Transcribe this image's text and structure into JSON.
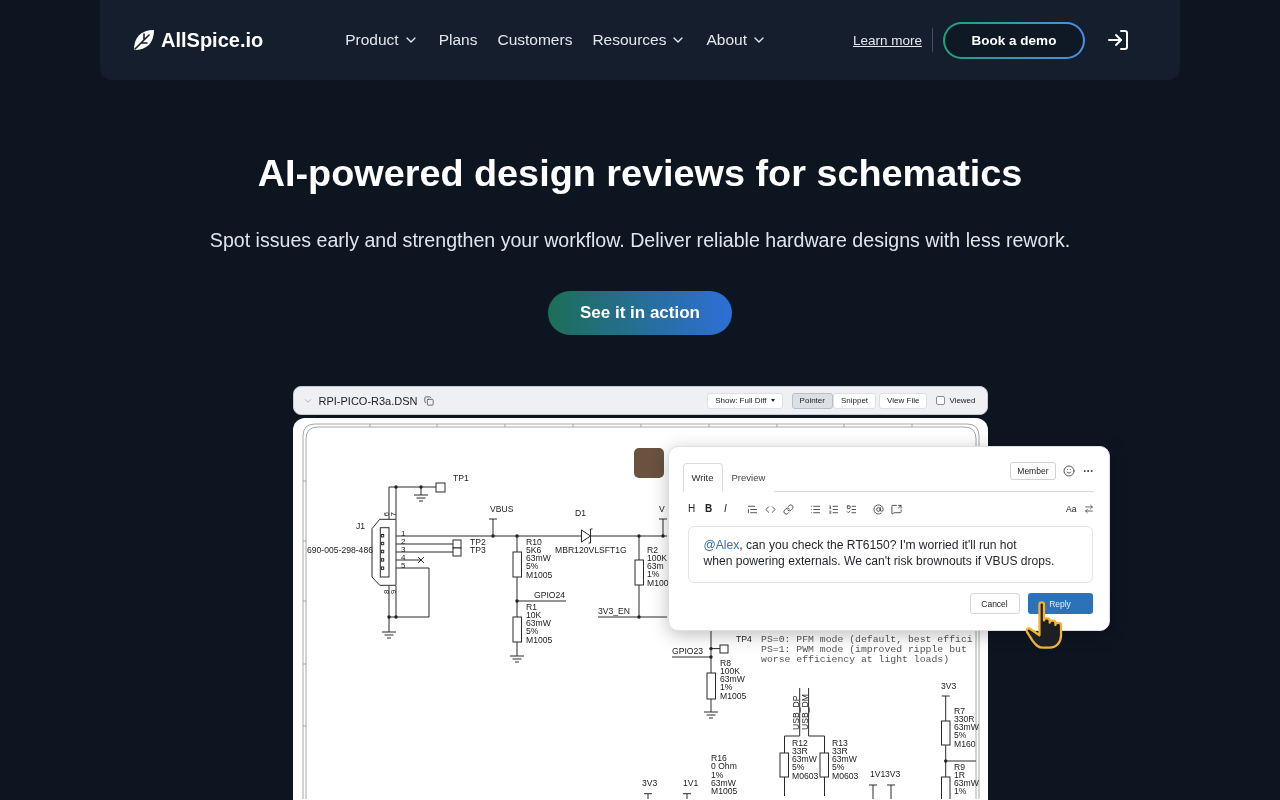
{
  "nav": {
    "logo": "AllSpice.io",
    "items": [
      {
        "label": "Product",
        "dropdown": true
      },
      {
        "label": "Plans",
        "dropdown": false
      },
      {
        "label": "Customers",
        "dropdown": false
      },
      {
        "label": "Resources",
        "dropdown": true
      },
      {
        "label": "About",
        "dropdown": true
      }
    ],
    "link": "Learn more",
    "button": "Book a demo"
  },
  "hero": {
    "title": "AI-powered design reviews for schematics",
    "subtitle": "Spot issues early and strengthen your workflow. Deliver reliable hardware designs with less rework.",
    "button": "See it in action"
  },
  "file_view": {
    "file_name": "RPI-PICO-R3a.DSN",
    "show_menu": "Show: Full Diff",
    "modes": [
      {
        "label": "Pointer",
        "selected": true
      },
      {
        "label": "Snippet",
        "selected": false
      }
    ],
    "view_button": "View File",
    "viewed": {
      "label": "Viewed",
      "checked": false
    }
  },
  "schematic": {
    "labels": [
      {
        "kind": "ref",
        "lines": [
          "TP1"
        ]
      },
      {
        "kind": "ref",
        "lines": [
          "J1"
        ]
      },
      {
        "kind": "ref",
        "lines": [
          "690-005-298-486"
        ]
      },
      {
        "kind": "pin",
        "lines": [
          "1"
        ]
      },
      {
        "kind": "pin",
        "lines": [
          "2"
        ]
      },
      {
        "kind": "pin",
        "lines": [
          "3"
        ]
      },
      {
        "kind": "pin",
        "lines": [
          "4"
        ]
      },
      {
        "kind": "pin",
        "lines": [
          "5"
        ]
      },
      {
        "kind": "pin_vertical",
        "lines": [
          "6"
        ]
      },
      {
        "kind": "pin_vertical",
        "lines": [
          "7"
        ]
      },
      {
        "kind": "pin_vertical",
        "lines": [
          "8"
        ]
      },
      {
        "kind": "pin_vertical",
        "lines": [
          "9"
        ]
      },
      {
        "kind": "net",
        "lines": [
          "VBUS"
        ]
      },
      {
        "kind": "ref",
        "lines": [
          "D1"
        ]
      },
      {
        "kind": "ref",
        "lines": [
          "MBR120VLSFT1G"
        ]
      },
      {
        "kind": "ref",
        "lines": [
          "TP2"
        ]
      },
      {
        "kind": "ref",
        "lines": [
          "TP3"
        ]
      },
      {
        "kind": "ref",
        "lines": [
          "R10",
          "5K6",
          "63mW",
          "5%",
          "M1005"
        ]
      },
      {
        "kind": "net",
        "lines": [
          "GPIO24"
        ]
      },
      {
        "kind": "ref",
        "lines": [
          "R1",
          "10K",
          "63mW",
          "5%",
          "M1005"
        ]
      },
      {
        "kind": "net",
        "lines": [
          "V"
        ]
      },
      {
        "kind": "ref",
        "lines": [
          "R2",
          "100K",
          "63m",
          "1%",
          "M100"
        ]
      },
      {
        "kind": "net",
        "lines": [
          "3V3_EN"
        ]
      },
      {
        "kind": "net",
        "lines": [
          "GPIO23"
        ]
      },
      {
        "kind": "ref",
        "lines": [
          "TP4"
        ]
      },
      {
        "kind": "note",
        "lines": [
          "PS=0: PFM mode (default, best effici",
          "PS=1: PWM mode (improved ripple but",
          "worse efficiency at light loads)"
        ]
      },
      {
        "kind": "ref",
        "lines": [
          "R8",
          "100K",
          "63mW",
          "1%",
          "M1005"
        ]
      },
      {
        "kind": "net_vertical",
        "lines": [
          "USB_DP"
        ]
      },
      {
        "kind": "net_vertical",
        "lines": [
          "USB_DM"
        ]
      },
      {
        "kind": "net",
        "lines": [
          "3V3"
        ]
      },
      {
        "kind": "ref",
        "lines": [
          "R7",
          "330R",
          "63mW",
          "5%",
          "M160"
        ]
      },
      {
        "kind": "net",
        "lines": [
          "3V3"
        ]
      },
      {
        "kind": "net",
        "lines": [
          "1V1"
        ]
      },
      {
        "kind": "ref",
        "lines": [
          "R12",
          "33R",
          "63mW",
          "5%",
          "M0603"
        ]
      },
      {
        "kind": "ref",
        "lines": [
          "R13",
          "33R",
          "63mW",
          "5%",
          "M0603"
        ]
      },
      {
        "kind": "ref",
        "lines": [
          "R16",
          "0 Ohm",
          "1%",
          "63mW",
          "M1005"
        ]
      },
      {
        "kind": "net",
        "lines": [
          "1V1"
        ]
      },
      {
        "kind": "net",
        "lines": [
          "3V3"
        ]
      },
      {
        "kind": "ref",
        "lines": [
          "R9",
          "1R",
          "63mW",
          "1%"
        ]
      }
    ]
  },
  "comment": {
    "tabs": [
      {
        "label": "Write",
        "selected": true
      },
      {
        "label": "Preview",
        "selected": false
      }
    ],
    "role": "Member",
    "toolbar_glyphs": [
      {
        "kind": "heading",
        "text": "H"
      },
      {
        "kind": "bold",
        "text": "B"
      },
      {
        "kind": "italic",
        "text": "I"
      }
    ],
    "font_toggle": "Aa",
    "mention": "@Alex",
    "body": [
      ", can you check the RT6150? I'm worried it'll run hot",
      "when powering externals. We can't risk brownouts if VBUS drops."
    ],
    "cancel": "Cancel",
    "reply": "Reply"
  }
}
